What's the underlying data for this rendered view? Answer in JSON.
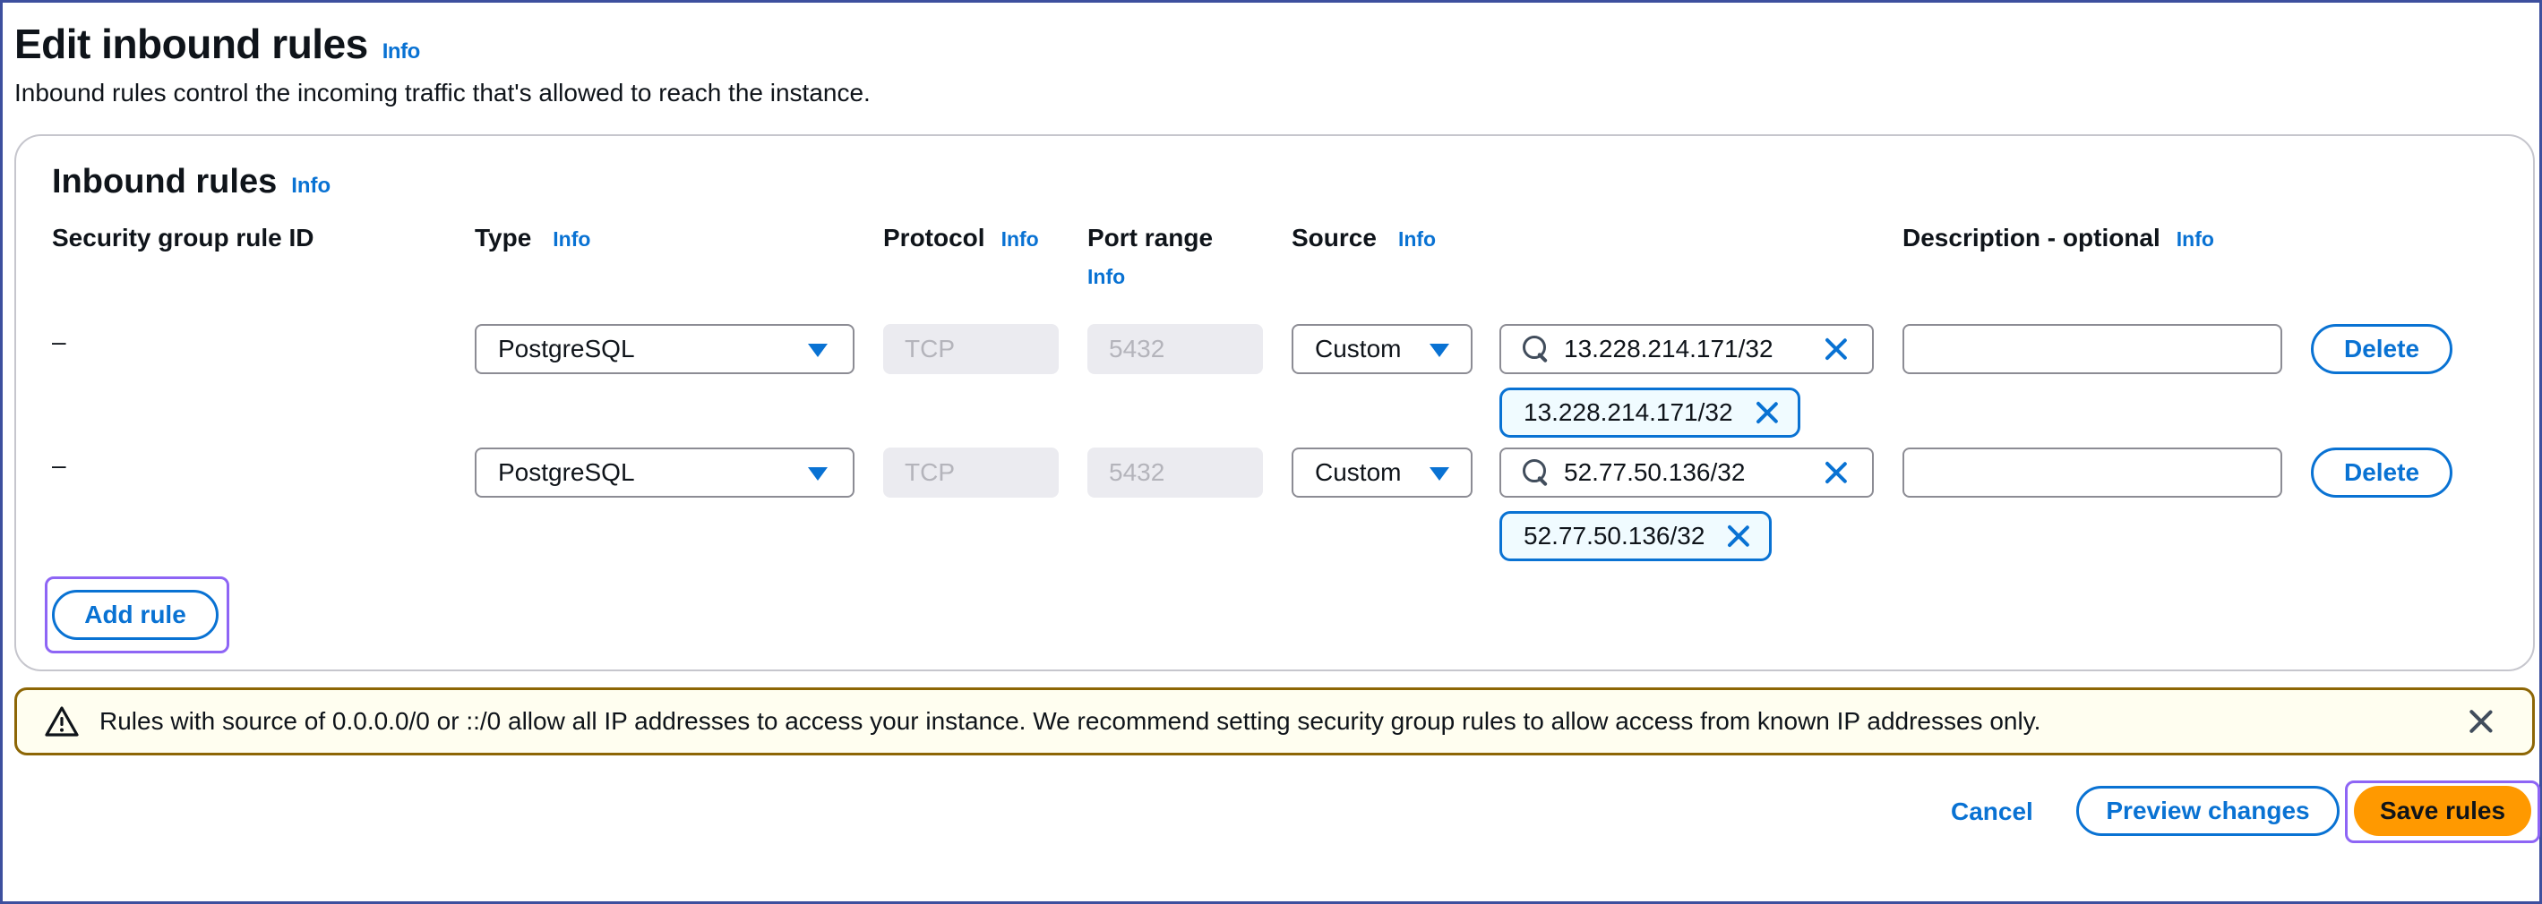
{
  "header": {
    "title": "Edit inbound rules",
    "info": "Info",
    "description": "Inbound rules control the incoming traffic that's allowed to reach the instance."
  },
  "panel": {
    "title": "Inbound rules",
    "info": "Info",
    "columns": {
      "rule_id": "Security group rule ID",
      "type": "Type",
      "type_info": "Info",
      "protocol": "Protocol",
      "protocol_info": "Info",
      "port_range": "Port range",
      "port_range_info": "Info",
      "source": "Source",
      "source_info": "Info",
      "description": "Description - optional",
      "description_info": "Info"
    },
    "rules": [
      {
        "rule_id": "–",
        "type": "PostgreSQL",
        "protocol": "TCP",
        "port_range": "5432",
        "source_type": "Custom",
        "source_search": "13.228.214.171/32",
        "source_token": "13.228.214.171/32",
        "description": "",
        "delete_label": "Delete"
      },
      {
        "rule_id": "–",
        "type": "PostgreSQL",
        "protocol": "TCP",
        "port_range": "5432",
        "source_type": "Custom",
        "source_search": "52.77.50.136/32",
        "source_token": "52.77.50.136/32",
        "description": "",
        "delete_label": "Delete"
      }
    ],
    "add_rule_label": "Add rule"
  },
  "alert": {
    "text": "Rules with source of 0.0.0.0/0 or ::/0 allow all IP addresses to access your instance. We recommend setting security group rules to allow access from known IP addresses only."
  },
  "footer": {
    "cancel_label": "Cancel",
    "preview_label": "Preview changes",
    "save_label": "Save rules"
  },
  "colors": {
    "accent": "#0972d3",
    "primary": "#ff9900",
    "warning_border": "#8d6605",
    "focus": "#8e65f5"
  }
}
